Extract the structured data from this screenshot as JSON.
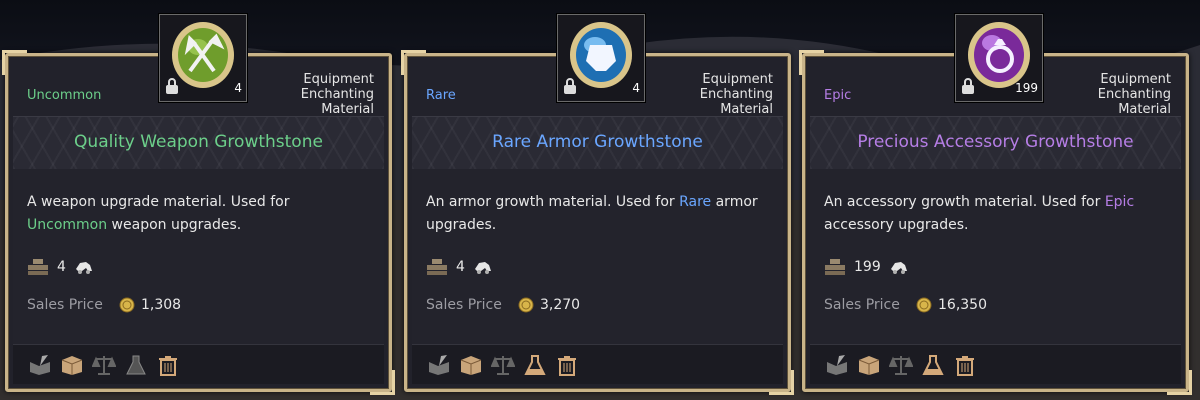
{
  "cards": [
    {
      "rarity": "Uncommon",
      "rarity_color": "#6ccf8a",
      "category": [
        "Equipment",
        "Enchanting",
        "Material"
      ],
      "name": "Quality Weapon Growthstone",
      "desc_1": "A weapon upgrade material. Used for",
      "desc_highlight": "Uncommon",
      "desc_2": " weapon upgrades.",
      "quantity": "4",
      "icon_count": "4",
      "icon_name": "green-gem-hammer-icon",
      "sales_label": "Sales Price",
      "price": "1,308"
    },
    {
      "rarity": "Rare",
      "rarity_color": "#6aa6ff",
      "category": [
        "Equipment",
        "Enchanting",
        "Material"
      ],
      "name": "Rare Armor Growthstone",
      "desc_1": "An armor growth material. Used for ",
      "desc_highlight": "Rare",
      "desc_2": " armor upgrades.",
      "quantity": "4",
      "icon_count": "4",
      "icon_name": "blue-gem-armor-icon",
      "sales_label": "Sales Price",
      "price": "3,270"
    },
    {
      "rarity": "Epic",
      "rarity_color": "#b67ee6",
      "category": [
        "Equipment",
        "Enchanting",
        "Material"
      ],
      "name": "Precious Accessory Growthstone",
      "desc_1": "An accessory growth material. Used for ",
      "desc_highlight": "Epic",
      "desc_2": " accessory upgrades.",
      "quantity": "199",
      "icon_count": "199",
      "icon_name": "purple-gem-ring-icon",
      "sales_label": "Sales Price",
      "price": "16,350"
    }
  ],
  "footer_icons": [
    "book-quill-icon",
    "crate-icon",
    "scale-icon",
    "flask-icon",
    "trash-icon"
  ],
  "colors": {
    "border_gold": "#c9b489",
    "panel": "#22222b",
    "coin": "#d8b54a"
  }
}
